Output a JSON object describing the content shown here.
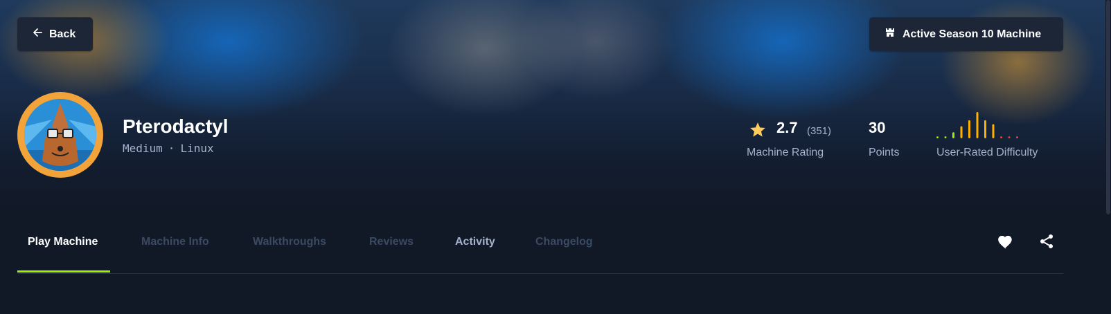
{
  "header": {
    "back_label": "Back",
    "season_label": "Active Season 10 Machine"
  },
  "machine": {
    "name": "Pterodactyl",
    "difficulty": "Medium",
    "separator": "·",
    "os": "Linux"
  },
  "stats": {
    "rating_value": "2.7",
    "rating_count": "(351)",
    "rating_label": "Machine Rating",
    "points_value": "30",
    "points_label": "Points",
    "difficulty_label": "User-Rated Difficulty",
    "difficulty_distribution": [
      1,
      1,
      3,
      6,
      9,
      13,
      9,
      7,
      1,
      1,
      1
    ],
    "difficulty_colors": [
      "#9fef00",
      "#9fef00",
      "#9fef00",
      "#ffaf00",
      "#ffaf00",
      "#ffaf00",
      "#ffaf00",
      "#ffaf00",
      "#ff3e3e",
      "#ff3e3e",
      "#ff3e3e"
    ]
  },
  "tabs": [
    {
      "label": "Play Machine",
      "state": "active"
    },
    {
      "label": "Machine Info",
      "state": "dim"
    },
    {
      "label": "Walkthroughs",
      "state": "dim"
    },
    {
      "label": "Reviews",
      "state": "dim"
    },
    {
      "label": "Activity",
      "state": "medium"
    },
    {
      "label": "Changelog",
      "state": "dim"
    }
  ],
  "icons": {
    "back": "arrow-left-icon",
    "season": "castle-icon",
    "rating": "star-icon",
    "favorite": "heart-icon",
    "share": "share-icon"
  },
  "colors": {
    "accent": "#9fef00",
    "star": "#ffcc5c",
    "background": "#111927"
  }
}
